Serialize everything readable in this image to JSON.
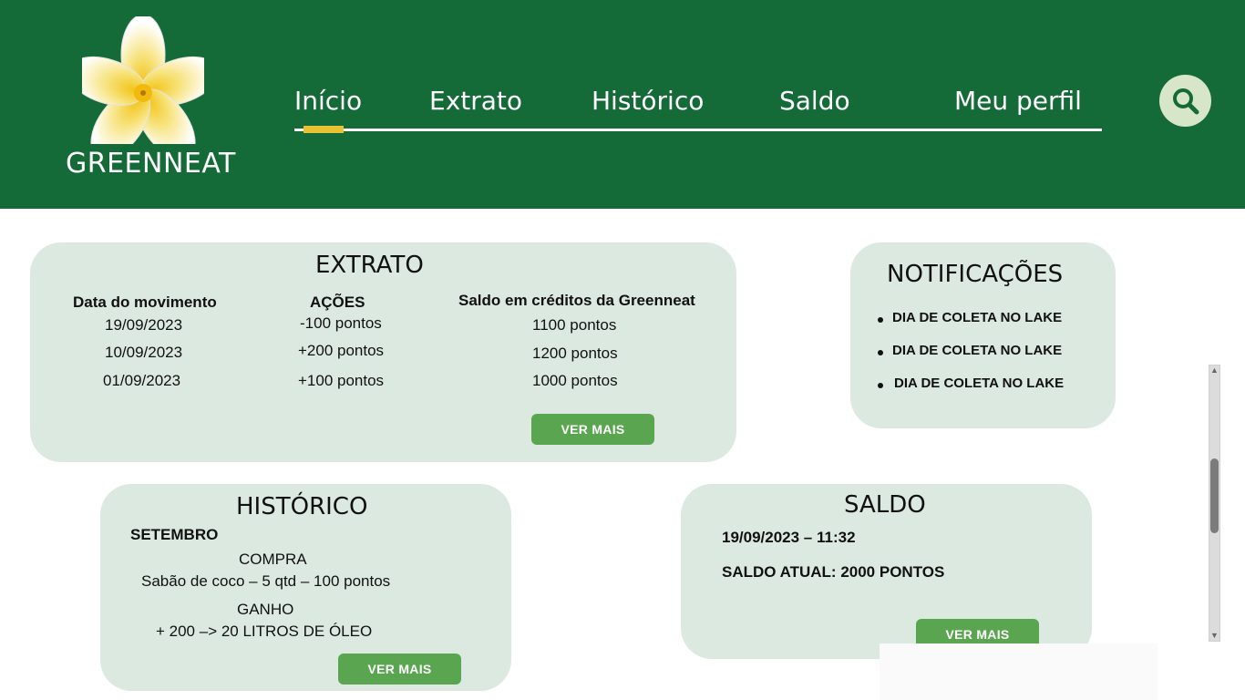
{
  "brand": {
    "name": "GREENNEAT"
  },
  "nav": {
    "items": [
      {
        "label": "Início",
        "active": true
      },
      {
        "label": "Extrato"
      },
      {
        "label": "Histórico"
      },
      {
        "label": "Saldo"
      },
      {
        "label": "Meu perfil"
      }
    ],
    "search_icon": "search-icon"
  },
  "extrato": {
    "title": "EXTRATO",
    "columns": [
      "Data do movimento",
      "AÇÕES",
      "Saldo em créditos da Greenneat"
    ],
    "rows": [
      {
        "date": "19/09/2023",
        "action": "-100 pontos",
        "balance": "1100 pontos"
      },
      {
        "date": "10/09/2023",
        "action": "+200 pontos",
        "balance": "1200 pontos"
      },
      {
        "date": "01/09/2023",
        "action": "+100 pontos",
        "balance": "1000 pontos"
      }
    ],
    "button": "VER MAIS"
  },
  "notificacoes": {
    "title": "NOTIFICAÇÕES",
    "items": [
      "DIA DE COLETA NO LAKE",
      "DIA DE COLETA NO LAKE",
      "DIA DE COLETA NO LAKE"
    ]
  },
  "historico": {
    "title": "HISTÓRICO",
    "month": "SETEMBRO",
    "entries": [
      {
        "type": "COMPRA",
        "detail": "Sabão de coco – 5 qtd – 100 pontos"
      },
      {
        "type": "GANHO",
        "detail": "+ 200 –> 20 LITROS DE ÓLEO"
      }
    ],
    "button": "VER MAIS"
  },
  "saldo": {
    "title": "SALDO",
    "timestamp": "19/09/2023 – 11:32",
    "current": "SALDO ATUAL: 2000 PONTOS",
    "button": "VER MAIS"
  },
  "colors": {
    "header_bg": "#156b38",
    "card_bg": "#dce9e0",
    "button_bg": "#5aa650",
    "nav_indicator": "#e6c234",
    "search_bg": "#d7e6c9"
  }
}
